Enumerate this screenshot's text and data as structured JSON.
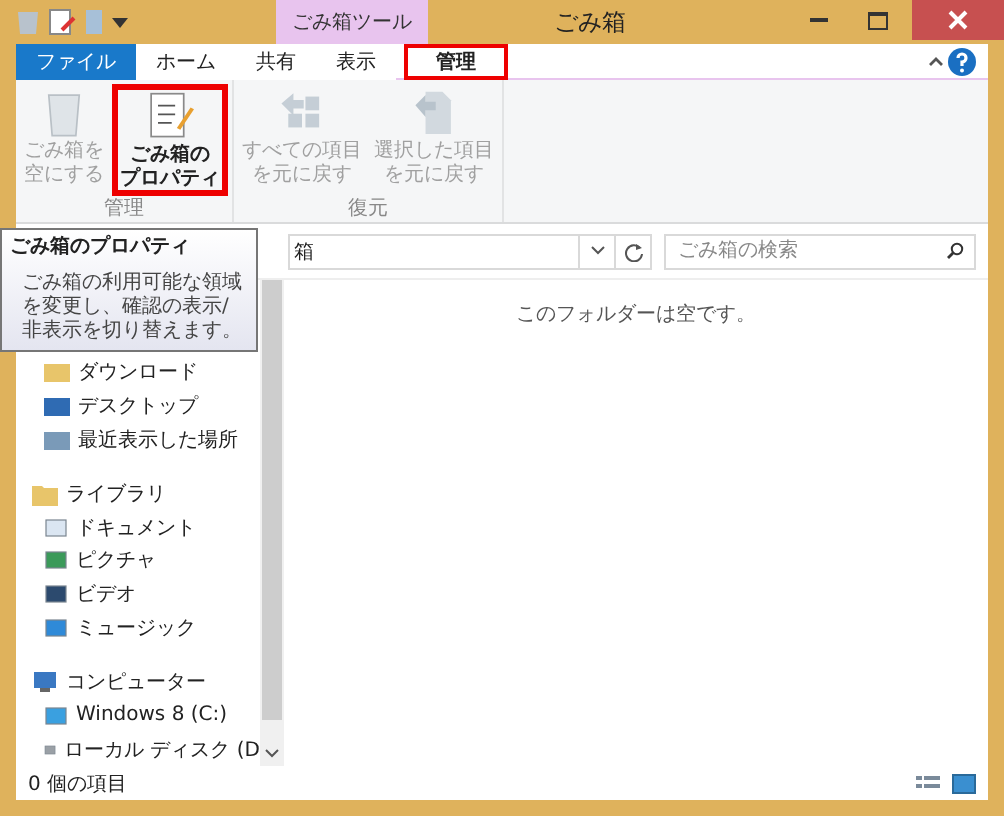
{
  "window": {
    "title": "ごみ箱",
    "context_tab": "ごみ箱ツール"
  },
  "ribbon_tabs": [
    {
      "label": "ファイル",
      "kind": "file",
      "selected": false,
      "highlighted": false
    },
    {
      "label": "ホーム",
      "kind": "tab",
      "selected": false,
      "highlighted": false
    },
    {
      "label": "共有",
      "kind": "tab",
      "selected": false,
      "highlighted": false
    },
    {
      "label": "表示",
      "kind": "tab",
      "selected": false,
      "highlighted": false
    },
    {
      "label": "管理",
      "kind": "tab",
      "selected": true,
      "highlighted": true
    }
  ],
  "ribbon_groups": [
    {
      "label": "管理",
      "buttons": [
        {
          "lines": [
            "ごみ箱を",
            "空にする"
          ],
          "disabled": true,
          "highlighted": false
        },
        {
          "lines": [
            "ごみ箱の",
            "プロパティ"
          ],
          "disabled": false,
          "highlighted": true
        }
      ]
    },
    {
      "label": "復元",
      "buttons": [
        {
          "lines": [
            "すべての項目",
            "を元に戻す"
          ],
          "disabled": true,
          "highlighted": false
        },
        {
          "lines": [
            "選択した項目",
            "を元に戻す"
          ],
          "disabled": true,
          "highlighted": false
        }
      ]
    }
  ],
  "address": {
    "value": "箱"
  },
  "search": {
    "placeholder": "ごみ箱の検索"
  },
  "nav": [
    {
      "label": "ダウンロード"
    },
    {
      "label": "デスクトップ"
    },
    {
      "label": "最近表示した場所"
    },
    {
      "label": "ライブラリ",
      "children": [
        {
          "label": "ドキュメント"
        },
        {
          "label": "ピクチャ"
        },
        {
          "label": "ビデオ"
        },
        {
          "label": "ミュージック"
        }
      ]
    },
    {
      "label": "コンピューター",
      "children": [
        {
          "label": "Windows 8 (C:)"
        },
        {
          "label": "ローカル ディスク (D"
        }
      ]
    }
  ],
  "content": {
    "empty_message": "このフォルダーは空です。"
  },
  "status_bar": {
    "count": "0 個の項目"
  },
  "tooltip": {
    "title": "ごみ箱のプロパティ",
    "body": "ごみ箱の利用可能な領域を変更し、確認の表示/非表示を切り替えます。"
  }
}
